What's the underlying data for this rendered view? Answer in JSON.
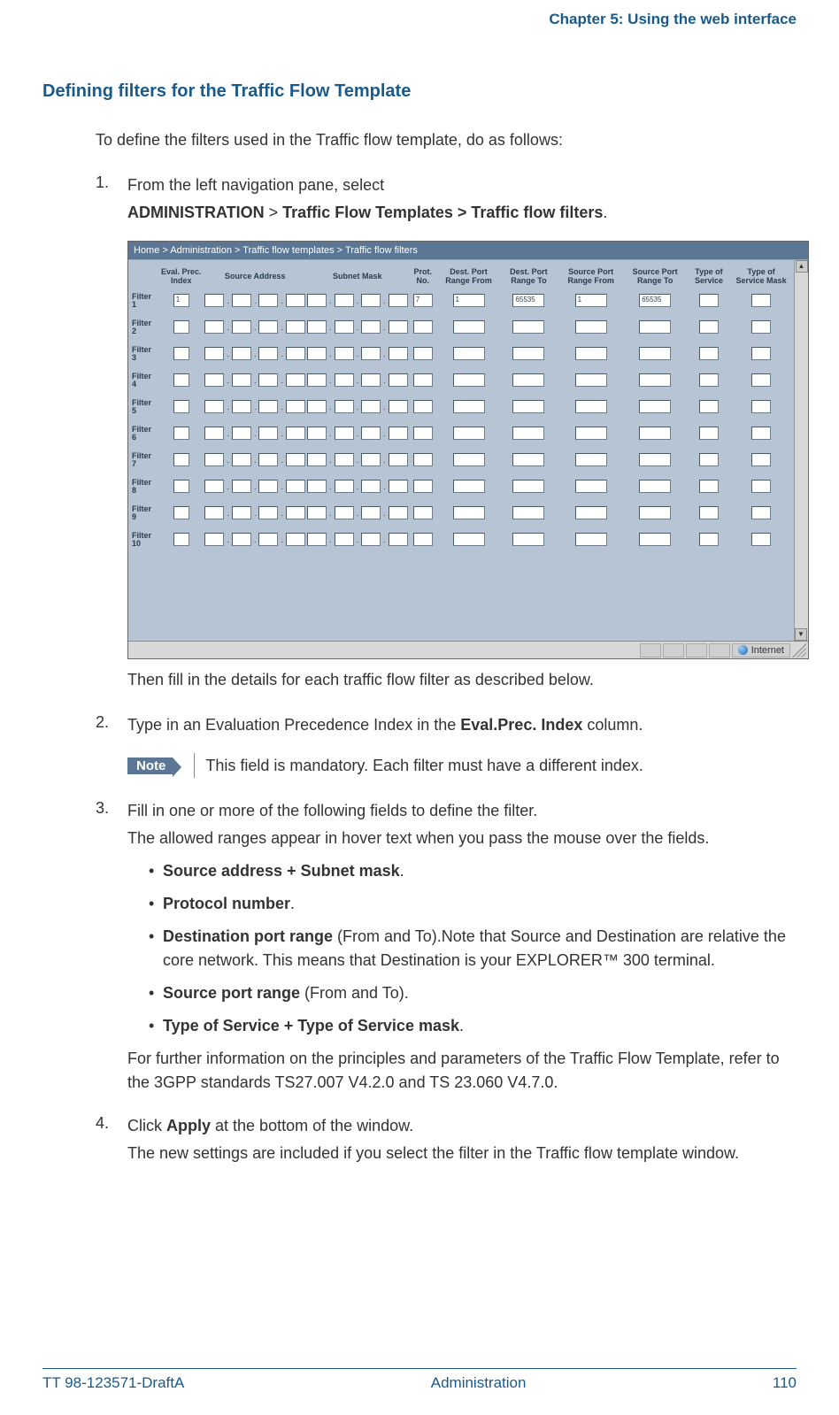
{
  "header": {
    "chapter": "Chapter 5: Using the web interface"
  },
  "section_title": "Defining filters for the Traffic Flow Template",
  "intro": "To define the filters used in the Traffic flow template, do as follows:",
  "step1": {
    "num": "1.",
    "line1": "From the left navigation pane, select",
    "nav_admin": "ADMINISTRATION",
    "gt": " > ",
    "nav_rest": "Traffic Flow Templates > Traffic flow filters",
    "after_shot": "Then fill in the details for each traffic flow filter as described below."
  },
  "ui": {
    "breadcrumb": "Home > Administration > Traffic flow templates > Traffic flow filters",
    "cols": {
      "eval": "Eval. Prec. Index",
      "src": "Source Address",
      "mask": "Subnet Mask",
      "prot": "Prot. No.",
      "dpf": "Dest. Port Range From",
      "dpt": "Dest. Port Range To",
      "spf": "Source Port Range From",
      "spt": "Source Port Range To",
      "tos": "Type of Service",
      "tosm": "Type of Service Mask"
    },
    "row_labels": [
      "Filter 1",
      "Filter 2",
      "Filter 3",
      "Filter 4",
      "Filter 5",
      "Filter 6",
      "Filter 7",
      "Filter 8",
      "Filter 9",
      "Filter 10"
    ],
    "r1": {
      "eval": "1",
      "prot": "7",
      "dpf": "1",
      "dpt": "65535",
      "spf": "1",
      "spt": "65535"
    },
    "status_zone": "Internet"
  },
  "step2": {
    "num": "2.",
    "text_a": "Type in an Evaluation Precedence Index in the ",
    "bold": "Eval.Prec. Index",
    "text_b": " column."
  },
  "note": {
    "label": "Note",
    "text": "This field is mandatory. Each filter must have a different index."
  },
  "step3": {
    "num": "3.",
    "l1": "Fill in one or more of the following fields to define the filter.",
    "l2": "The allowed ranges appear in hover text when you pass the mouse over the fields.",
    "b1a": "Source address + Subnet mask",
    "b2a": "Protocol number",
    "b3a": "Destination port range",
    "b3b": " (From and To).Note that Source and Destination are relative the core network. This means that Destination is your EXPLORER™ 300 terminal.",
    "b4a": "Source port range",
    "b4b": " (From and To).",
    "b5a": "Type of Service + Type of Service mask",
    "after": "For further information on the principles and parameters of the Traffic Flow Template, refer to the 3GPP standards TS27.007 V4.2.0 and TS 23.060 V4.7.0."
  },
  "step4": {
    "num": "4.",
    "l1a": "Click ",
    "l1b": "Apply",
    "l1c": " at the bottom of the window.",
    "l2": "The new settings are included if you select the filter in the Traffic flow template window."
  },
  "footer": {
    "left": "TT 98-123571-DraftA",
    "mid": "Administration",
    "right": "110"
  }
}
